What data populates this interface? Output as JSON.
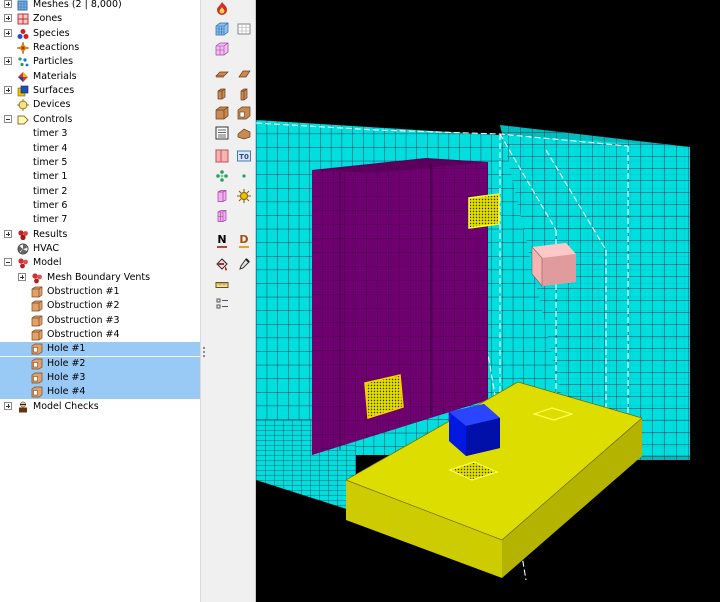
{
  "tree": {
    "items": [
      {
        "label": "Meshes (2 | 8,000)",
        "icon": "mesh-icon",
        "expander": "plus"
      },
      {
        "label": "Zones",
        "icon": "zones-icon",
        "expander": "plus"
      },
      {
        "label": "Species",
        "icon": "species-icon",
        "expander": "plus"
      },
      {
        "label": "Reactions",
        "icon": "reactions-icon",
        "expander": "none"
      },
      {
        "label": "Particles",
        "icon": "particles-icon",
        "expander": "plus"
      },
      {
        "label": "Materials",
        "icon": "materials-icon",
        "expander": "none"
      },
      {
        "label": "Surfaces",
        "icon": "surfaces-icon",
        "expander": "plus"
      },
      {
        "label": "Devices",
        "icon": "devices-icon",
        "expander": "none"
      },
      {
        "label": "Controls",
        "icon": "controls-icon",
        "expander": "minus"
      },
      {
        "label": "timer 3",
        "icon": "none",
        "expander": "none",
        "indent": 1
      },
      {
        "label": "timer 4",
        "icon": "none",
        "expander": "none",
        "indent": 1
      },
      {
        "label": "timer 5",
        "icon": "none",
        "expander": "none",
        "indent": 1
      },
      {
        "label": "timer 1",
        "icon": "none",
        "expander": "none",
        "indent": 1
      },
      {
        "label": "timer 2",
        "icon": "none",
        "expander": "none",
        "indent": 1
      },
      {
        "label": "timer 6",
        "icon": "none",
        "expander": "none",
        "indent": 1
      },
      {
        "label": "timer 7",
        "icon": "none",
        "expander": "none",
        "indent": 1
      },
      {
        "label": "Results",
        "icon": "results-icon",
        "expander": "plus"
      },
      {
        "label": "HVAC",
        "icon": "hvac-icon",
        "expander": "none"
      },
      {
        "label": "Model",
        "icon": "model-icon",
        "expander": "minus"
      },
      {
        "label": "Mesh Boundary Vents",
        "icon": "vents-icon",
        "expander": "plus",
        "indent": 1
      },
      {
        "label": "Obstruction #1",
        "icon": "obstruction-icon",
        "expander": "none",
        "indent": 1
      },
      {
        "label": "Obstruction #2",
        "icon": "obstruction-icon",
        "expander": "none",
        "indent": 1
      },
      {
        "label": "Obstruction #3",
        "icon": "obstruction-icon",
        "expander": "none",
        "indent": 1
      },
      {
        "label": "Obstruction #4",
        "icon": "obstruction-icon",
        "expander": "none",
        "indent": 1
      },
      {
        "label": "Hole #1",
        "icon": "hole-icon",
        "expander": "none",
        "indent": 1,
        "selected": true
      },
      {
        "label": "Hole #2",
        "icon": "hole-icon",
        "expander": "none",
        "indent": 1,
        "selected": true
      },
      {
        "label": "Hole #3",
        "icon": "hole-icon",
        "expander": "none",
        "indent": 1,
        "selected": true
      },
      {
        "label": "Hole #4",
        "icon": "hole-icon",
        "expander": "none",
        "indent": 1,
        "selected": true
      },
      {
        "label": "Model Checks",
        "icon": "model-checks-icon",
        "expander": "plus"
      }
    ],
    "selection_color": "#99c9f5"
  },
  "toolbar": {
    "buttons": [
      {
        "name": "fire-icon",
        "col": 0,
        "row": 0
      },
      {
        "name": "new-mesh-icon",
        "col": 0,
        "row": 1
      },
      {
        "name": "mesh-grid-icon",
        "col": 1,
        "row": 1
      },
      {
        "name": "split-mesh-icon",
        "col": 0,
        "row": 2
      },
      {
        "name": "new-slab-icon",
        "col": 0,
        "row": 3
      },
      {
        "name": "new-plane-icon",
        "col": 1,
        "row": 3
      },
      {
        "name": "new-obstruction-icon",
        "col": 0,
        "row": 4
      },
      {
        "name": "new-wall-icon",
        "col": 1,
        "row": 4
      },
      {
        "name": "new-block-icon",
        "col": 0,
        "row": 5
      },
      {
        "name": "new-hole-icon",
        "col": 1,
        "row": 5
      },
      {
        "name": "new-stair-icon",
        "col": 0,
        "row": 6
      },
      {
        "name": "new-roof-icon",
        "col": 1,
        "row": 6
      },
      {
        "name": "new-vent-icon",
        "col": 0,
        "row": 7
      },
      {
        "name": "temperature-device-icon",
        "col": 1,
        "row": 7
      },
      {
        "name": "particle-cloud-icon",
        "col": 0,
        "row": 8
      },
      {
        "name": "point-device-icon",
        "col": 1,
        "row": 8
      },
      {
        "name": "door-icon",
        "col": 0,
        "row": 9
      },
      {
        "name": "fire-source-icon",
        "col": 1,
        "row": 9
      },
      {
        "name": "window-icon",
        "col": 0,
        "row": 10
      },
      {
        "name": "north-arrow-icon",
        "col": 0,
        "row": 11,
        "text": "N"
      },
      {
        "name": "dimension-icon",
        "col": 1,
        "row": 11,
        "text": "D"
      },
      {
        "name": "paint-bucket-icon",
        "col": 0,
        "row": 12
      },
      {
        "name": "eyedropper-icon",
        "col": 1,
        "row": 12
      },
      {
        "name": "ruler-icon",
        "col": 0,
        "row": 13
      },
      {
        "name": "list-icon",
        "col": 0,
        "row": 14
      }
    ]
  },
  "colors": {
    "wall_cyan": "#00dede",
    "floor_yellow": "#dddd00",
    "obstruction_purple": "#6e0070",
    "block_blue": "#0018e0",
    "block_pink": "#f5b4b4",
    "grid_line": "#1f3c55",
    "background": "#000000"
  }
}
